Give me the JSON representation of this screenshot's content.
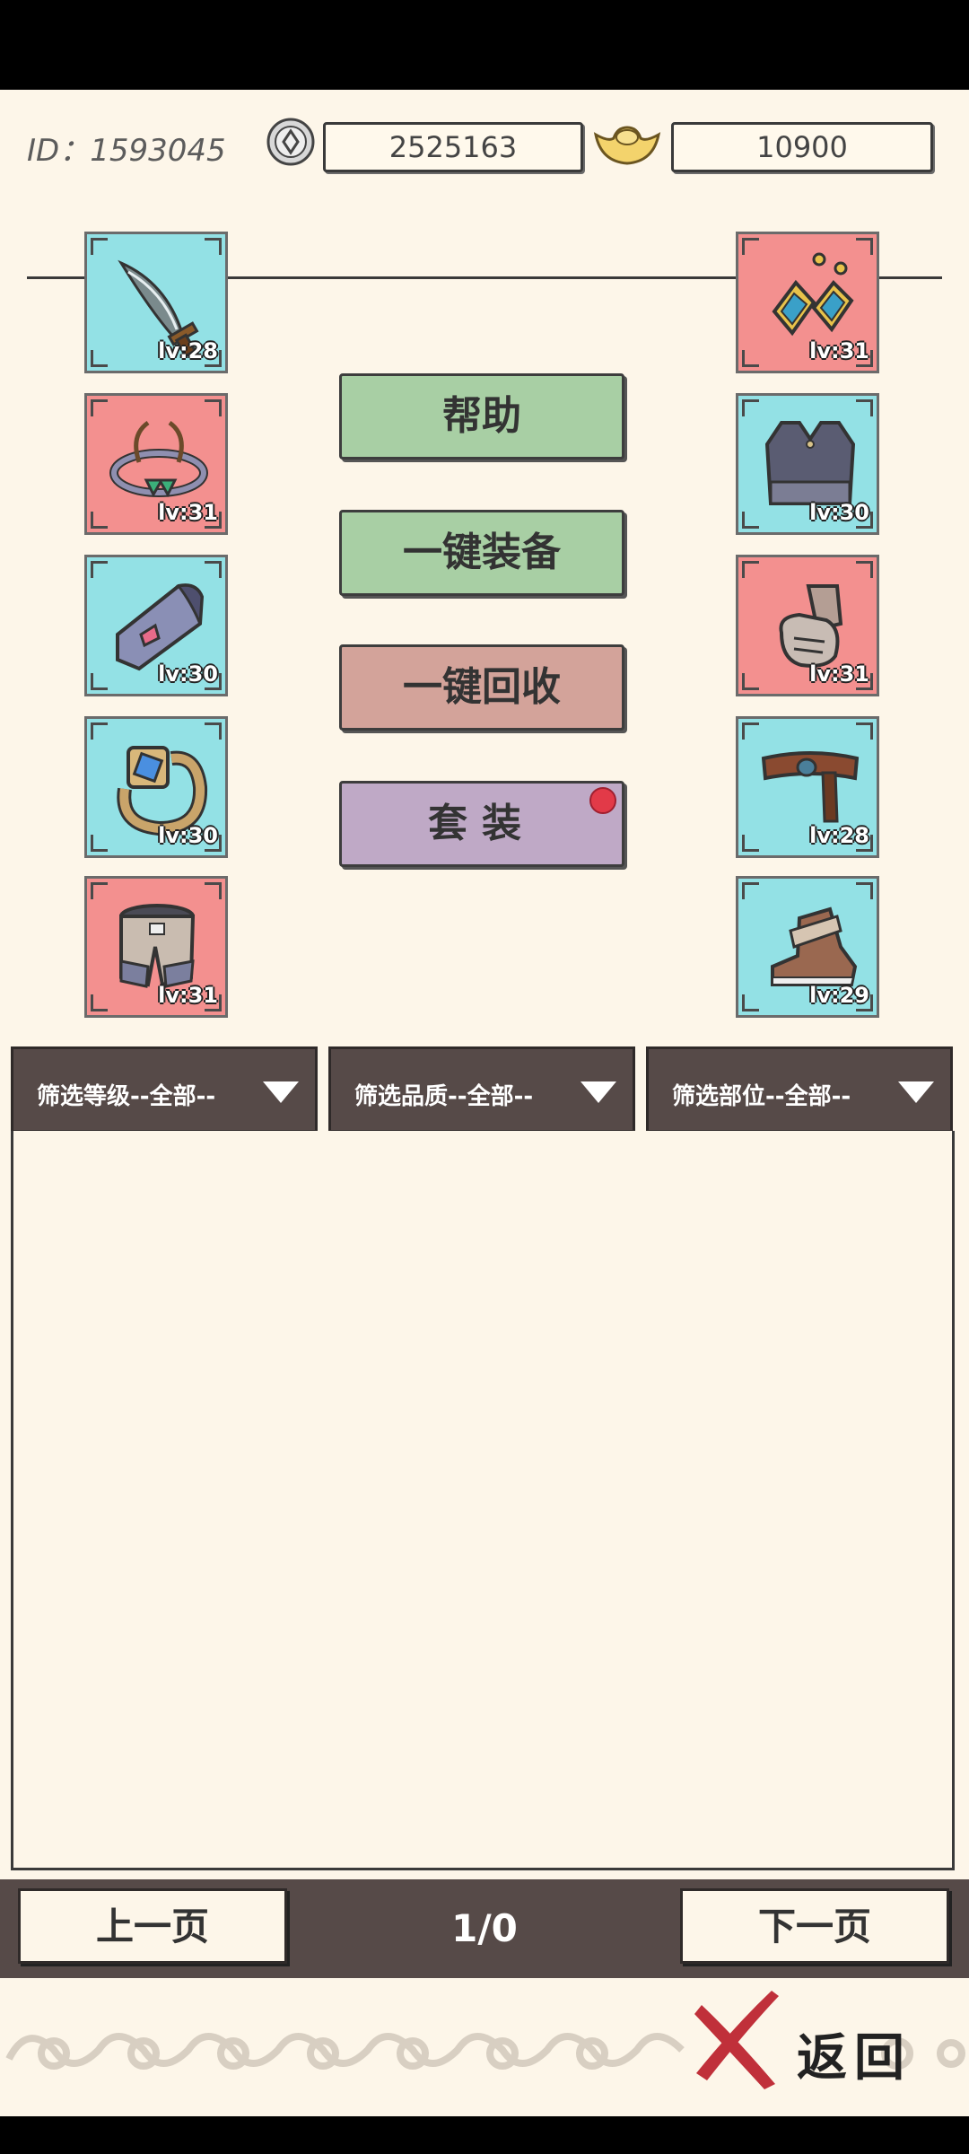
{
  "header": {
    "id_label": "ID：1593045",
    "coin_value": "2525163",
    "ingot_value": "10900",
    "coin_icon": "coin-icon",
    "ingot_icon": "gold-ingot-icon"
  },
  "slots_left": [
    {
      "item": "dagger",
      "level": "lv:28",
      "color": "#93e1e5"
    },
    {
      "item": "circlet",
      "level": "lv:31",
      "color": "#f3908f"
    },
    {
      "item": "bracer",
      "level": "lv:30",
      "color": "#93e1e5"
    },
    {
      "item": "ring",
      "level": "lv:30",
      "color": "#93e1e5"
    },
    {
      "item": "pants",
      "level": "lv:31",
      "color": "#f3908f"
    }
  ],
  "slots_right": [
    {
      "item": "earrings",
      "level": "lv:31",
      "color": "#f3908f"
    },
    {
      "item": "vest",
      "level": "lv:30",
      "color": "#93e1e5"
    },
    {
      "item": "gauntlet",
      "level": "lv:31",
      "color": "#f3908f"
    },
    {
      "item": "belt",
      "level": "lv:28",
      "color": "#93e1e5"
    },
    {
      "item": "boots",
      "level": "lv:29",
      "color": "#93e1e5"
    }
  ],
  "menu": {
    "help": "帮助",
    "one_click_equip": "一键装备",
    "one_click_recycle": "一键回收",
    "set": "套装"
  },
  "filters": {
    "level": "筛选等级--全部--",
    "quality": "筛选品质--全部--",
    "slot": "筛选部位--全部--"
  },
  "pager": {
    "prev": "上一页",
    "page": "1/0",
    "next": "下一页"
  },
  "footer": {
    "back": "返回"
  },
  "colors": {
    "green_button": "#a8cfa4",
    "red_button": "#d3a39a",
    "purple_button": "#bfa9c6",
    "dark_panel": "#564a48",
    "cyan_slot": "#93e1e5",
    "red_slot": "#f3908f"
  }
}
